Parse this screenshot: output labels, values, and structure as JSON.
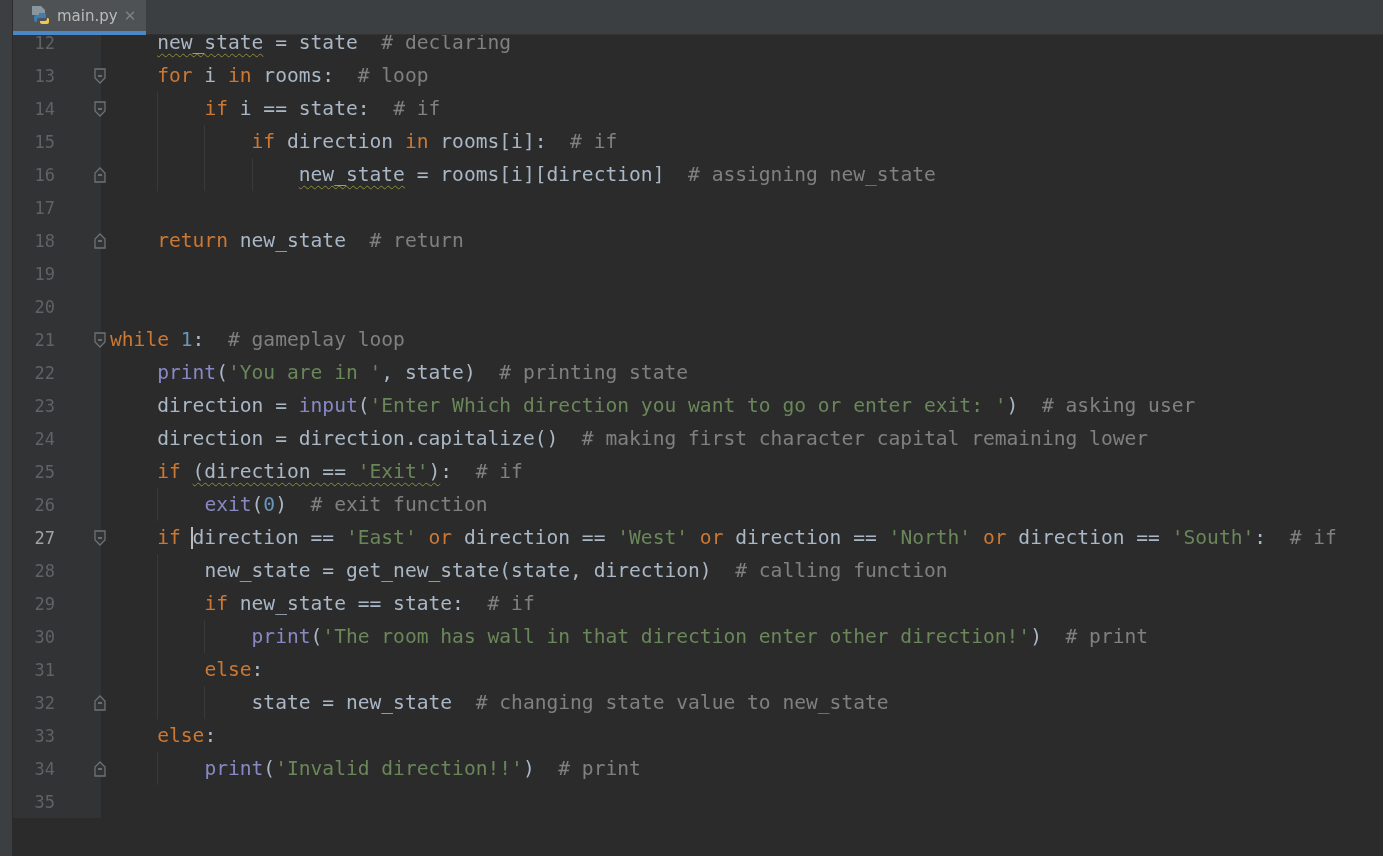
{
  "tabs": [
    {
      "label": "main.py",
      "selected": true,
      "close": "✕"
    }
  ],
  "lines": [
    {
      "number": "12",
      "current": false,
      "fold_start": false,
      "fold_end": false,
      "tokens": [
        {
          "kind": "text",
          "text": "    new_state",
          "warn": true,
          "caret": false
        },
        {
          "kind": "text",
          "text": " = state  ",
          "warn": false,
          "caret": false
        },
        {
          "kind": "comment",
          "text": "# declaring",
          "warn": false,
          "caret": false
        }
      ]
    },
    {
      "number": "13",
      "current": false,
      "fold_start": true,
      "fold_end": false,
      "tokens": [
        {
          "kind": "kw",
          "text": "    for",
          "warn": false,
          "caret": false
        },
        {
          "kind": "text",
          "text": " i ",
          "warn": false,
          "caret": false
        },
        {
          "kind": "kw",
          "text": "in",
          "warn": false,
          "caret": false
        },
        {
          "kind": "text",
          "text": " rooms:  ",
          "warn": false,
          "caret": false
        },
        {
          "kind": "comment",
          "text": "# loop",
          "warn": false,
          "caret": false
        }
      ]
    },
    {
      "number": "14",
      "current": false,
      "fold_start": true,
      "fold_end": false,
      "tokens": [
        {
          "kind": "kw",
          "text": "        if",
          "warn": false,
          "caret": false
        },
        {
          "kind": "text",
          "text": " i == state:  ",
          "warn": false,
          "caret": false
        },
        {
          "kind": "comment",
          "text": "# if",
          "warn": false,
          "caret": false
        }
      ]
    },
    {
      "number": "15",
      "current": false,
      "fold_start": false,
      "fold_end": false,
      "tokens": [
        {
          "kind": "kw",
          "text": "            if",
          "warn": false,
          "caret": false
        },
        {
          "kind": "text",
          "text": " direction ",
          "warn": false,
          "caret": false
        },
        {
          "kind": "kw",
          "text": "in",
          "warn": false,
          "caret": false
        },
        {
          "kind": "text",
          "text": " rooms[i]:  ",
          "warn": false,
          "caret": false
        },
        {
          "kind": "comment",
          "text": "# if",
          "warn": false,
          "caret": false
        }
      ]
    },
    {
      "number": "16",
      "current": false,
      "fold_start": false,
      "fold_end": true,
      "tokens": [
        {
          "kind": "text",
          "text": "                new_state",
          "warn": true,
          "caret": false
        },
        {
          "kind": "text",
          "text": " = rooms[i][direction]  ",
          "warn": false,
          "caret": false
        },
        {
          "kind": "comment",
          "text": "# assigning new_state",
          "warn": false,
          "caret": false
        }
      ]
    },
    {
      "number": "17",
      "current": false,
      "fold_start": false,
      "fold_end": false
    },
    {
      "number": "18",
      "current": false,
      "fold_start": false,
      "fold_end": true,
      "tokens": [
        {
          "kind": "kw",
          "text": "    return",
          "warn": false,
          "caret": false
        },
        {
          "kind": "text",
          "text": " new_state  ",
          "warn": false,
          "caret": false
        },
        {
          "kind": "comment",
          "text": "# return",
          "warn": false,
          "caret": false
        }
      ]
    },
    {
      "number": "19",
      "current": false,
      "fold_start": false,
      "fold_end": false
    },
    {
      "number": "20",
      "current": false,
      "fold_start": false,
      "fold_end": false
    },
    {
      "number": "21",
      "current": false,
      "fold_start": true,
      "fold_end": false,
      "tokens": [
        {
          "kind": "kw",
          "text": "while",
          "warn": false,
          "caret": false
        },
        {
          "kind": "num",
          "text": " 1",
          "warn": false,
          "caret": false
        },
        {
          "kind": "text",
          "text": ":  ",
          "warn": false,
          "caret": false
        },
        {
          "kind": "comment",
          "text": "# gameplay loop",
          "warn": false,
          "caret": false
        }
      ]
    },
    {
      "number": "22",
      "current": false,
      "fold_start": false,
      "fold_end": false,
      "tokens": [
        {
          "kind": "builtin",
          "text": "    print",
          "warn": false,
          "caret": false
        },
        {
          "kind": "text",
          "text": "(",
          "warn": false,
          "caret": false
        },
        {
          "kind": "str",
          "text": "'You are in '",
          "warn": false,
          "caret": false
        },
        {
          "kind": "text",
          "text": ", state)  ",
          "warn": false,
          "caret": false
        },
        {
          "kind": "comment",
          "text": "# printing state",
          "warn": false,
          "caret": false
        }
      ]
    },
    {
      "number": "23",
      "current": false,
      "fold_start": false,
      "fold_end": false,
      "tokens": [
        {
          "kind": "text",
          "text": "    direction = ",
          "warn": false,
          "caret": false
        },
        {
          "kind": "builtin",
          "text": "input",
          "warn": false,
          "caret": false
        },
        {
          "kind": "text",
          "text": "(",
          "warn": false,
          "caret": false
        },
        {
          "kind": "str",
          "text": "'Enter Which direction you want to go or enter exit: '",
          "warn": false,
          "caret": false
        },
        {
          "kind": "text",
          "text": ")  ",
          "warn": false,
          "caret": false
        },
        {
          "kind": "comment",
          "text": "# asking user",
          "warn": false,
          "caret": false
        }
      ]
    },
    {
      "number": "24",
      "current": false,
      "fold_start": false,
      "fold_end": false,
      "tokens": [
        {
          "kind": "text",
          "text": "    direction = direction.capitalize()  ",
          "warn": false,
          "caret": false
        },
        {
          "kind": "comment",
          "text": "# making first character capital remaining lower",
          "warn": false,
          "caret": false
        }
      ]
    },
    {
      "number": "25",
      "current": false,
      "fold_start": false,
      "fold_end": false,
      "tokens": [
        {
          "kind": "kw",
          "text": "    if ",
          "warn": false,
          "caret": false
        },
        {
          "kind": "text",
          "text": "(direction == ",
          "warn": true,
          "caret": false
        },
        {
          "kind": "str",
          "text": "'Exit'",
          "warn": true,
          "caret": false
        },
        {
          "kind": "text",
          "text": ")",
          "warn": true,
          "caret": false
        },
        {
          "kind": "text",
          "text": ":  ",
          "warn": false,
          "caret": false
        },
        {
          "kind": "comment",
          "text": "# if",
          "warn": false,
          "caret": false
        }
      ]
    },
    {
      "number": "26",
      "current": false,
      "fold_start": false,
      "fold_end": false,
      "tokens": [
        {
          "kind": "builtin",
          "text": "        exit",
          "warn": false,
          "caret": false
        },
        {
          "kind": "text",
          "text": "(",
          "warn": false,
          "caret": false
        },
        {
          "kind": "num",
          "text": "0",
          "warn": false,
          "caret": false
        },
        {
          "kind": "text",
          "text": ")  ",
          "warn": false,
          "caret": false
        },
        {
          "kind": "comment",
          "text": "# exit function",
          "warn": false,
          "caret": false
        }
      ]
    },
    {
      "number": "27",
      "current": true,
      "fold_start": true,
      "fold_end": false,
      "tokens": [
        {
          "kind": "kw",
          "text": "    if ",
          "warn": false,
          "caret": false
        },
        {
          "kind": "text",
          "text": "direction == ",
          "warn": false,
          "caret": true
        },
        {
          "kind": "str",
          "text": "'East'",
          "warn": false,
          "caret": false
        },
        {
          "kind": "kw",
          "text": " or",
          "warn": false,
          "caret": false
        },
        {
          "kind": "text",
          "text": " direction == ",
          "warn": false,
          "caret": false
        },
        {
          "kind": "str",
          "text": "'West'",
          "warn": false,
          "caret": false
        },
        {
          "kind": "kw",
          "text": " or",
          "warn": false,
          "caret": false
        },
        {
          "kind": "text",
          "text": " direction == ",
          "warn": false,
          "caret": false
        },
        {
          "kind": "str",
          "text": "'North'",
          "warn": false,
          "caret": false
        },
        {
          "kind": "kw",
          "text": " or",
          "warn": false,
          "caret": false
        },
        {
          "kind": "text",
          "text": " direction == ",
          "warn": false,
          "caret": false
        },
        {
          "kind": "str",
          "text": "'South'",
          "warn": false,
          "caret": false
        },
        {
          "kind": "text",
          "text": ":  ",
          "warn": false,
          "caret": false
        },
        {
          "kind": "comment",
          "text": "# if",
          "warn": false,
          "caret": false
        }
      ]
    },
    {
      "number": "28",
      "current": false,
      "fold_start": false,
      "fold_end": false,
      "tokens": [
        {
          "kind": "text",
          "text": "        new_state = get_new_state(state, direction)  ",
          "warn": false,
          "caret": false
        },
        {
          "kind": "comment",
          "text": "# calling function",
          "warn": false,
          "caret": false
        }
      ]
    },
    {
      "number": "29",
      "current": false,
      "fold_start": false,
      "fold_end": false,
      "tokens": [
        {
          "kind": "kw",
          "text": "        if",
          "warn": false,
          "caret": false
        },
        {
          "kind": "text",
          "text": " new_state == state:  ",
          "warn": false,
          "caret": false
        },
        {
          "kind": "comment",
          "text": "# if",
          "warn": false,
          "caret": false
        }
      ]
    },
    {
      "number": "30",
      "current": false,
      "fold_start": false,
      "fold_end": false,
      "tokens": [
        {
          "kind": "builtin",
          "text": "            print",
          "warn": false,
          "caret": false
        },
        {
          "kind": "text",
          "text": "(",
          "warn": false,
          "caret": false
        },
        {
          "kind": "str",
          "text": "'The room has wall in that direction enter other direction!'",
          "warn": false,
          "caret": false
        },
        {
          "kind": "text",
          "text": ")  ",
          "warn": false,
          "caret": false
        },
        {
          "kind": "comment",
          "text": "# print",
          "warn": false,
          "caret": false
        }
      ]
    },
    {
      "number": "31",
      "current": false,
      "fold_start": false,
      "fold_end": false,
      "tokens": [
        {
          "kind": "kw",
          "text": "        else",
          "warn": false,
          "caret": false
        },
        {
          "kind": "text",
          "text": ":",
          "warn": false,
          "caret": false
        }
      ]
    },
    {
      "number": "32",
      "current": false,
      "fold_start": false,
      "fold_end": true,
      "tokens": [
        {
          "kind": "text",
          "text": "            state = new_state  ",
          "warn": false,
          "caret": false
        },
        {
          "kind": "comment",
          "text": "# changing state value to new_state",
          "warn": false,
          "caret": false
        }
      ]
    },
    {
      "number": "33",
      "current": false,
      "fold_start": false,
      "fold_end": false,
      "tokens": [
        {
          "kind": "kw",
          "text": "    else",
          "warn": false,
          "caret": false
        },
        {
          "kind": "text",
          "text": ":",
          "warn": false,
          "caret": false
        }
      ]
    },
    {
      "number": "34",
      "current": false,
      "fold_start": false,
      "fold_end": true,
      "tokens": [
        {
          "kind": "builtin",
          "text": "        print",
          "warn": false,
          "caret": false
        },
        {
          "kind": "text",
          "text": "(",
          "warn": false,
          "caret": false
        },
        {
          "kind": "str",
          "text": "'Invalid direction!!'",
          "warn": false,
          "caret": false
        },
        {
          "kind": "text",
          "text": ")  ",
          "warn": false,
          "caret": false
        },
        {
          "kind": "comment",
          "text": "# print",
          "warn": false,
          "caret": false
        }
      ]
    },
    {
      "number": "35",
      "current": false,
      "fold_start": false,
      "fold_end": false
    }
  ]
}
